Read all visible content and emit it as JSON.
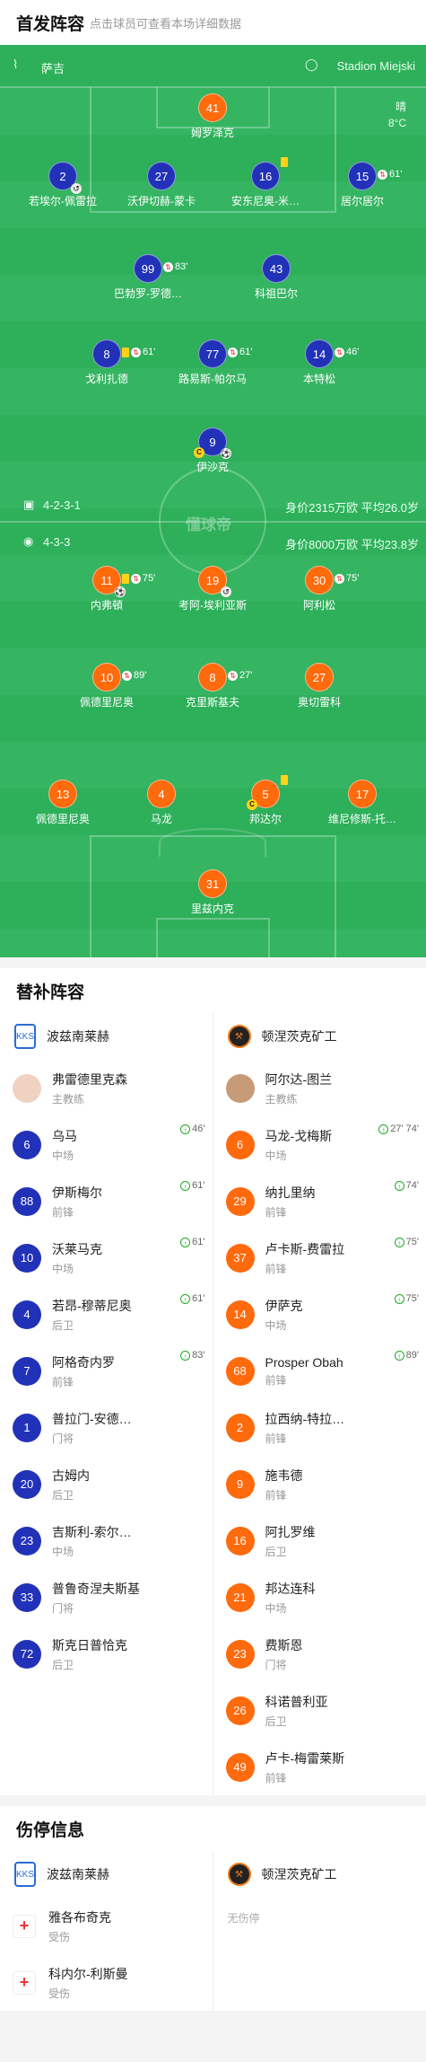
{
  "lineup_header": {
    "title": "首发阵容",
    "subtitle": "点击球员可查看本场详细数据"
  },
  "pitch": {
    "home_team": "萨吉",
    "stadium": "Stadion Miejski",
    "weather": "晴",
    "temperature": "8°C",
    "watermark": "懂球帝",
    "home_formation": "4-2-3-1",
    "home_value": "身价2315万欧 平均26.0岁",
    "away_formation": "4-3-3",
    "away_value": "身价8000万欧 平均23.8岁",
    "home_players": [
      {
        "num": "41",
        "name": "姆罗泽克"
      },
      {
        "num": "2",
        "name": "若埃尔-佩雷拉"
      },
      {
        "num": "27",
        "name": "沃伊切赫-蒙卡"
      },
      {
        "num": "16",
        "name": "安东尼奥-米…",
        "event": ""
      },
      {
        "num": "15",
        "name": "居尔居尔",
        "event": "61'"
      },
      {
        "num": "99",
        "name": "巴勃罗-罗德…",
        "event": "83'"
      },
      {
        "num": "43",
        "name": "科祖巴尔"
      },
      {
        "num": "8",
        "name": "戈利扎德",
        "event": "61'"
      },
      {
        "num": "77",
        "name": "路易斯-帕尔马",
        "event": "61'"
      },
      {
        "num": "14",
        "name": "本特松",
        "event": "46'"
      },
      {
        "num": "9",
        "name": "伊沙克"
      }
    ],
    "away_players": [
      {
        "num": "11",
        "name": "内弗頓",
        "event": "75'"
      },
      {
        "num": "19",
        "name": "考阿-埃利亚斯"
      },
      {
        "num": "30",
        "name": "阿利松",
        "event": "75'"
      },
      {
        "num": "10",
        "name": "佩德里尼奥",
        "event": "89'"
      },
      {
        "num": "8",
        "name": "克里斯基夫",
        "event": "27'"
      },
      {
        "num": "27",
        "name": "奥切雷科"
      },
      {
        "num": "13",
        "name": "佩德里尼奥"
      },
      {
        "num": "4",
        "name": "马龙"
      },
      {
        "num": "5",
        "name": "邦达尔"
      },
      {
        "num": "17",
        "name": "维尼修斯-托…"
      },
      {
        "num": "31",
        "name": "里兹内克"
      }
    ]
  },
  "subs": {
    "title": "替补阵容",
    "home_team": "波兹南莱赫",
    "away_team": "顿涅茨克矿工",
    "home_coach": {
      "name": "弗雷德里克森",
      "role": "主教练"
    },
    "away_coach": {
      "name": "阿尔达-图兰",
      "role": "主教练"
    },
    "home": [
      {
        "num": "6",
        "name": "乌马",
        "pos": "中场",
        "event": "46'"
      },
      {
        "num": "88",
        "name": "伊斯梅尔",
        "pos": "前锋",
        "event": "61'"
      },
      {
        "num": "10",
        "name": "沃莱马克",
        "pos": "中场",
        "event": "61'"
      },
      {
        "num": "4",
        "name": "若昂-穆蒂尼奥",
        "pos": "后卫",
        "event": "61'"
      },
      {
        "num": "7",
        "name": "阿格奇内罗",
        "pos": "前锋",
        "event": "83'"
      },
      {
        "num": "1",
        "name": "普拉门-安德…",
        "pos": "门将",
        "event": ""
      },
      {
        "num": "20",
        "name": "古姆内",
        "pos": "后卫",
        "event": ""
      },
      {
        "num": "23",
        "name": "吉斯利-索尔…",
        "pos": "中场",
        "event": ""
      },
      {
        "num": "33",
        "name": "普鲁奇涅夫斯基",
        "pos": "门将",
        "event": ""
      },
      {
        "num": "72",
        "name": "斯克日普恰克",
        "pos": "后卫",
        "event": ""
      }
    ],
    "away": [
      {
        "num": "6",
        "name": "马龙-戈梅斯",
        "pos": "中场",
        "event": "27' 74'"
      },
      {
        "num": "29",
        "name": "纳扎里纳",
        "pos": "前锋",
        "event": "74'"
      },
      {
        "num": "37",
        "name": "卢卡斯-费雷拉",
        "pos": "前锋",
        "event": "75'"
      },
      {
        "num": "14",
        "name": "伊萨克",
        "pos": "中场",
        "event": "75'"
      },
      {
        "num": "68",
        "name": "Prosper Obah",
        "pos": "前锋",
        "event": "89'"
      },
      {
        "num": "2",
        "name": "拉西纳-特拉…",
        "pos": "前锋",
        "event": ""
      },
      {
        "num": "9",
        "name": "施韦德",
        "pos": "前锋",
        "event": ""
      },
      {
        "num": "16",
        "name": "阿扎罗维",
        "pos": "后卫",
        "event": ""
      },
      {
        "num": "21",
        "name": "邦达连科",
        "pos": "中场",
        "event": ""
      },
      {
        "num": "23",
        "name": "费斯恩",
        "pos": "门将",
        "event": ""
      },
      {
        "num": "26",
        "name": "科诺普利亚",
        "pos": "后卫",
        "event": ""
      },
      {
        "num": "49",
        "name": "卢卡-梅雷莱斯",
        "pos": "前锋",
        "event": ""
      }
    ]
  },
  "injury": {
    "title": "伤停信息",
    "home_team": "波兹南莱赫",
    "away_team": "顿涅茨克矿工",
    "home": [
      {
        "name": "雅各布奇克",
        "status": "受伤"
      },
      {
        "name": "科内尔-利斯曼",
        "status": "受伤"
      }
    ],
    "away_none": "无伤停"
  }
}
